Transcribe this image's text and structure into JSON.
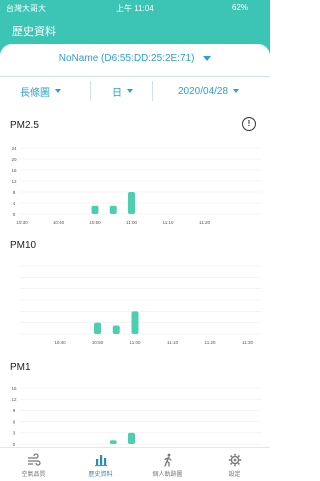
{
  "statusbar": {
    "carrier": "台灣大哥大",
    "time": "上午 11:04",
    "battery": "62%"
  },
  "navbar": {
    "title": "歷史資料"
  },
  "device": {
    "name": "NoName (D6:55:DD:25:2E:71)"
  },
  "filters": {
    "chart_type": "長條圖",
    "period": "日",
    "date": "2020/04/28"
  },
  "chart_data": [
    {
      "type": "bar",
      "title": "PM2.5",
      "yticks": [
        0,
        4,
        8,
        12,
        16,
        20,
        24
      ],
      "xticks": [
        "10:30",
        "10:40",
        "10:50",
        "11:00",
        "11:10",
        "11:20"
      ],
      "x": [
        "10:50",
        "10:55",
        "11:00"
      ],
      "values": [
        3,
        3,
        8
      ],
      "ylim": [
        0,
        24
      ],
      "color": "#4ccfae"
    },
    {
      "type": "bar",
      "title": "PM10",
      "yticks": [],
      "xticks": [
        "10:40",
        "10:50",
        "11:00",
        "11:10",
        "11:20",
        "11:30"
      ],
      "x": [
        "10:50",
        "10:55",
        "11:00"
      ],
      "values": [
        4,
        3,
        8
      ],
      "ylim": [
        0,
        24
      ],
      "color": "#4ccfae"
    },
    {
      "type": "bar",
      "title": "PM1",
      "yticks": [
        0,
        3,
        6,
        9,
        12,
        15
      ],
      "xticks": [],
      "x": [
        "10:55",
        "11:00"
      ],
      "values": [
        1,
        3
      ],
      "ylim": [
        0,
        15
      ],
      "color": "#4ccfae"
    }
  ],
  "tabs": [
    {
      "label": "空氣品質",
      "icon": "wind-icon",
      "active": false
    },
    {
      "label": "歷史資料",
      "icon": "bar-chart-icon",
      "active": true
    },
    {
      "label": "個人軌跡圖",
      "icon": "walking-person-icon",
      "active": false
    },
    {
      "label": "設定",
      "icon": "gear-icon",
      "active": false
    }
  ],
  "colors": {
    "header": "#3cc4b4",
    "accent": "#2aa3c8",
    "bar": "#4ccfae",
    "active_tab": "#2a8fb2"
  }
}
